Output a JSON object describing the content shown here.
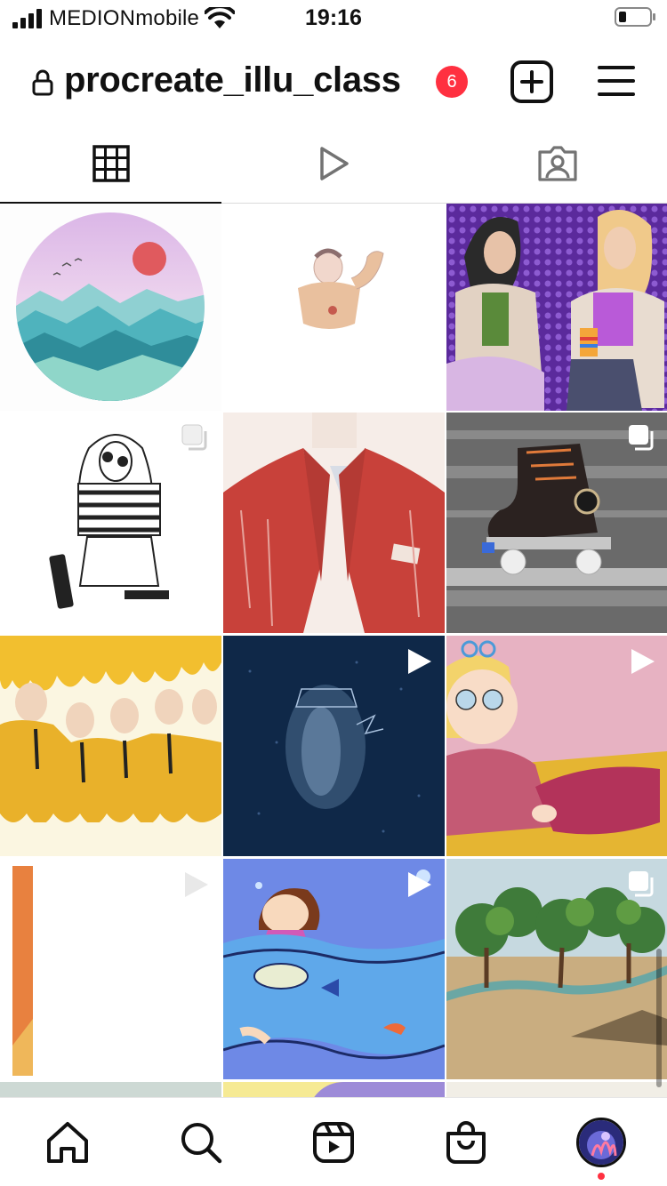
{
  "status_bar": {
    "carrier": "MEDIONmobile",
    "time": "19:16"
  },
  "header": {
    "username": "procreate_illu_class",
    "notification_count": "6",
    "accent_color": "#ff3040"
  },
  "tabs": [
    {
      "name": "posts-grid-icon",
      "active": true
    },
    {
      "name": "reels-play-icon",
      "active": false
    },
    {
      "name": "tagged-person-icon",
      "active": false
    }
  ],
  "grid": {
    "posts": [
      {
        "subject": "mountain sunset in circle",
        "overlay": "none"
      },
      {
        "subject": "man flexing arm sketch",
        "overlay": "reel"
      },
      {
        "subject": "two women on purple background",
        "overlay": "none"
      },
      {
        "subject": "girl with striped shirt line drawing",
        "overlay": "carousel"
      },
      {
        "subject": "red jacket close-up",
        "overlay": "none"
      },
      {
        "subject": "roller skate",
        "overlay": "carousel"
      },
      {
        "subject": "band in yellow melting suits",
        "overlay": "none"
      },
      {
        "subject": "bed in dark blue night",
        "overlay": "reel"
      },
      {
        "subject": "blonde character lying down",
        "overlay": "reel"
      },
      {
        "subject": "orange stripe on white",
        "overlay": "reel"
      },
      {
        "subject": "girl swimming in blue waves",
        "overlay": "reel"
      },
      {
        "subject": "trees landscape",
        "overlay": "carousel"
      }
    ]
  },
  "bottom_nav": [
    {
      "name": "home-icon"
    },
    {
      "name": "search-icon"
    },
    {
      "name": "reels-icon"
    },
    {
      "name": "shop-icon"
    },
    {
      "name": "profile-avatar"
    }
  ]
}
